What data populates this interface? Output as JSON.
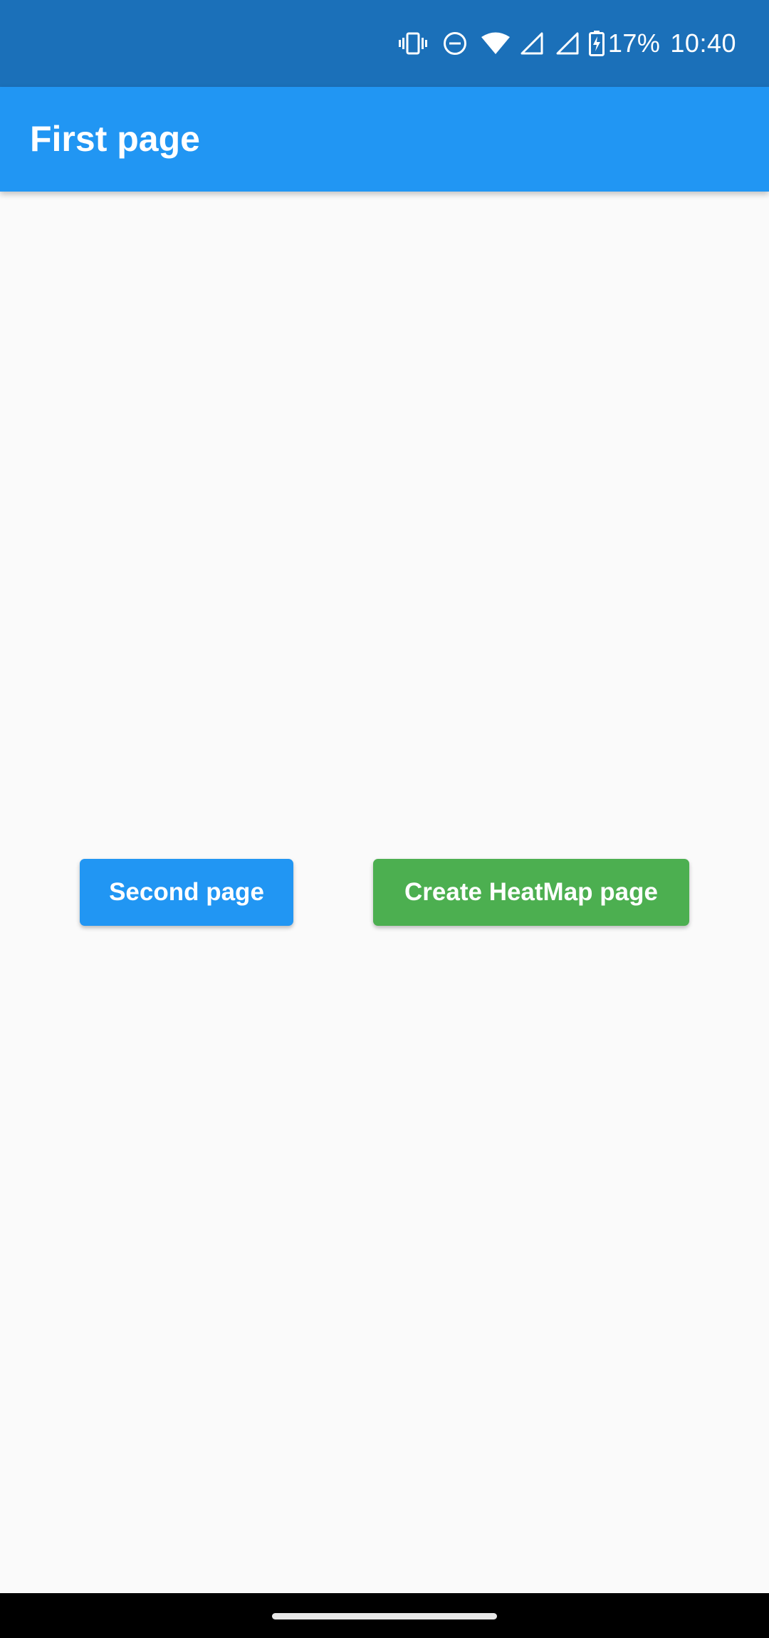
{
  "status_bar": {
    "icons": [
      "vibrate-icon",
      "do-not-disturb-icon",
      "wifi-icon",
      "signal-icon",
      "signal-icon",
      "battery-charging-icon"
    ],
    "battery_percent": "17%",
    "time": "10:40"
  },
  "app_bar": {
    "title": "First page",
    "color": "#2196f3"
  },
  "buttons": {
    "second_page": {
      "label": "Second page",
      "color": "#2196f3"
    },
    "create_heatmap": {
      "label": "Create HeatMap page",
      "color": "#4caf50"
    }
  },
  "colors": {
    "status_bar": "#1b70b9",
    "background": "#fafafa",
    "navigation_bar": "#000000"
  }
}
